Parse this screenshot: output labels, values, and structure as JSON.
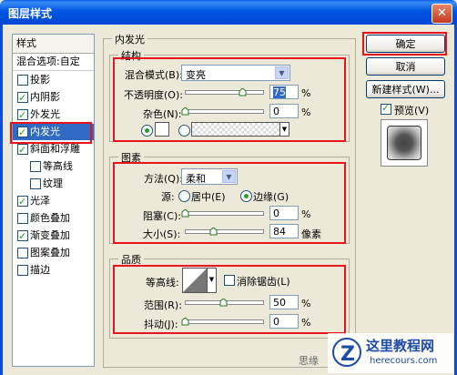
{
  "window": {
    "title": "图层样式",
    "close_glyph": "✕"
  },
  "styles_panel": {
    "header": "样式",
    "blend_options": "混合选项:自定",
    "items": [
      {
        "label": "投影",
        "checked": false
      },
      {
        "label": "内阴影",
        "checked": true
      },
      {
        "label": "外发光",
        "checked": true
      },
      {
        "label": "内发光",
        "checked": true,
        "selected": true
      },
      {
        "label": "斜面和浮雕",
        "checked": true
      },
      {
        "label": "等高线",
        "checked": false,
        "sub": true
      },
      {
        "label": "纹理",
        "checked": false,
        "sub": true
      },
      {
        "label": "光泽",
        "checked": true
      },
      {
        "label": "颜色叠加",
        "checked": false
      },
      {
        "label": "渐变叠加",
        "checked": true
      },
      {
        "label": "图案叠加",
        "checked": false
      },
      {
        "label": "描边",
        "checked": false
      }
    ]
  },
  "inner_glow": {
    "title": "内发光",
    "structure": {
      "title": "结构",
      "blend_mode_label": "混合模式(B):",
      "blend_mode_value": "变亮",
      "opacity_label": "不透明度(O):",
      "opacity_value": "75",
      "noise_label": "杂色(N):",
      "noise_value": "0",
      "percent": "%"
    },
    "elements": {
      "title": "图素",
      "method_label": "方法(Q):",
      "method_value": "柔和",
      "source_label": "源:",
      "source_center": "居中(E)",
      "source_edge": "边缘(G)",
      "choke_label": "阻塞(C):",
      "choke_value": "0",
      "size_label": "大小(S):",
      "size_value": "84",
      "percent": "%",
      "px_unit": "像素"
    },
    "quality": {
      "title": "品质",
      "contour_label": "等高线:",
      "anti_alias_label": "消除锯齿(L)",
      "range_label": "范围(R):",
      "range_value": "50",
      "jitter_label": "抖动(J):",
      "jitter_value": "0",
      "percent": "%"
    }
  },
  "buttons": {
    "ok": "确定",
    "cancel": "取消",
    "new_style": "新建样式(W)...",
    "preview_label": "预览(V)"
  },
  "watermark": {
    "brand": "这里教程网",
    "url": "herecours.com",
    "partial_text": "思缘"
  }
}
